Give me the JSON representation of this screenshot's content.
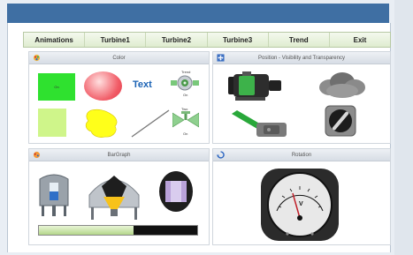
{
  "tabs": [
    "Animations",
    "Turbine1",
    "Turbine2",
    "Turbine3",
    "Trend",
    "Exit"
  ],
  "panels": {
    "color": {
      "title": "Color"
    },
    "position": {
      "title": "Position - Visibility and Transparency"
    },
    "fill": {
      "title": "BarGraph"
    },
    "rotation": {
      "title": "Rotation"
    }
  },
  "color_panel": {
    "green_box_label": "On",
    "text_label": "Text",
    "valve1_top": "Trend",
    "valve1_bottom": "On",
    "valve2_top": "Two",
    "valve2_bottom": "On"
  },
  "meter": {
    "unit": "V"
  },
  "bargraph": {
    "fill_fraction": 0.6
  },
  "colors": {
    "accent": "#3f6fa3",
    "green": "#2fe12f",
    "light_green": "#cff58a",
    "yellow": "#ffff1a",
    "text_blue": "#1b63b5"
  }
}
